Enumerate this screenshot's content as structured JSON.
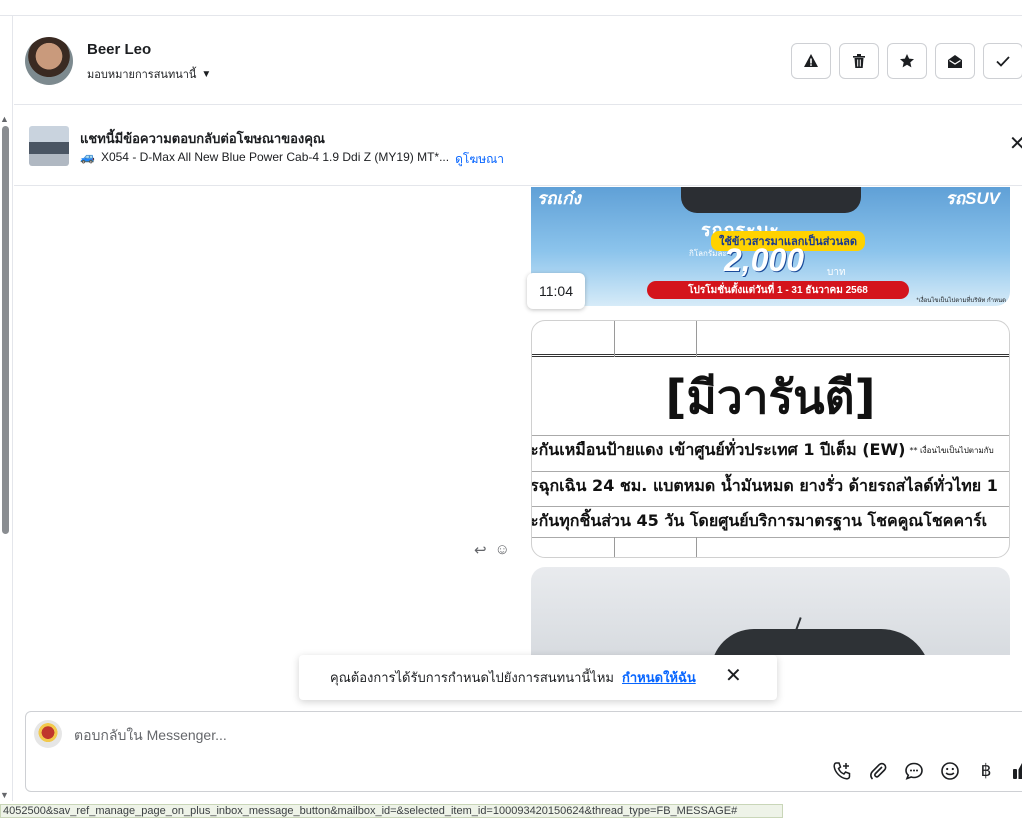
{
  "header": {
    "contact_name": "Beer Leo",
    "assign_label": "มอบหมายการสนทนานี้"
  },
  "ad_banner": {
    "title": "แชทนี้มีข้อความตอบกลับต่อโฆษณาของคุณ",
    "vehicle_emoji": "🚙",
    "subtitle": "X054 - D-Max All New Blue Power Cab-4 1.9 Ddi Z (MY19) MT*...",
    "link_label": "ดูโฆษณา",
    "close_glyph": "✕"
  },
  "messages": {
    "promo_image": {
      "left_tag": "รถเก๋ง",
      "right_tag": "รถSUV",
      "middle": "รถกระบะ",
      "pill": "ใช้ข้าวสารมาแลกเป็นส่วนลด",
      "per_kg": "กิโลกรัมละ",
      "price": "2,000",
      "unit": "บาท",
      "band": "โปรโมชั่นตั้งแต่วันที่ 1 - 31 ธันวาคม 2568",
      "fine_print": "*เงื่อนไขเป็นไปตามที่บริษัท กำหนด"
    },
    "timestamp": "11:04",
    "warranty_image": {
      "heading": "[มีวารันตี]",
      "rows": [
        {
          "text": "ะกันเหมือนป้ายแดง เข้าศูนย์ทั่วประเทศ 1 ปีเต็ม (EW)",
          "note": "** เงื่อนไขเป็นไปตามกับ"
        },
        {
          "text": "รฉุกเฉิน 24 ชม. แบตหมด น้ำมันหมด ยางรั่ว ด้ายรถสไลด์ทั่วไทย 1",
          "note": ""
        },
        {
          "text": "ะกันทุกชิ้นส่วน 45 วัน โดยศูนย์บริการมาตรฐาน โชคคูณโชคคาร์เ",
          "note": ""
        }
      ]
    },
    "reply_glyph": "↩",
    "emoji_glyph": "☺"
  },
  "toast": {
    "text": "คุณต้องการได้รับการกำหนดไปยังการสนทนานี้ไหม",
    "link_label": "กำหนดให้ฉัน",
    "close_glyph": "✕"
  },
  "composer": {
    "placeholder": "ตอบกลับใน Messenger...",
    "baht_glyph": "฿"
  },
  "status_url": "4052500&sav_ref_manage_page_on_plus_inbox_message_button&mailbox_id=&selected_item_id=100093420150624&thread_type=FB_MESSAGE#"
}
